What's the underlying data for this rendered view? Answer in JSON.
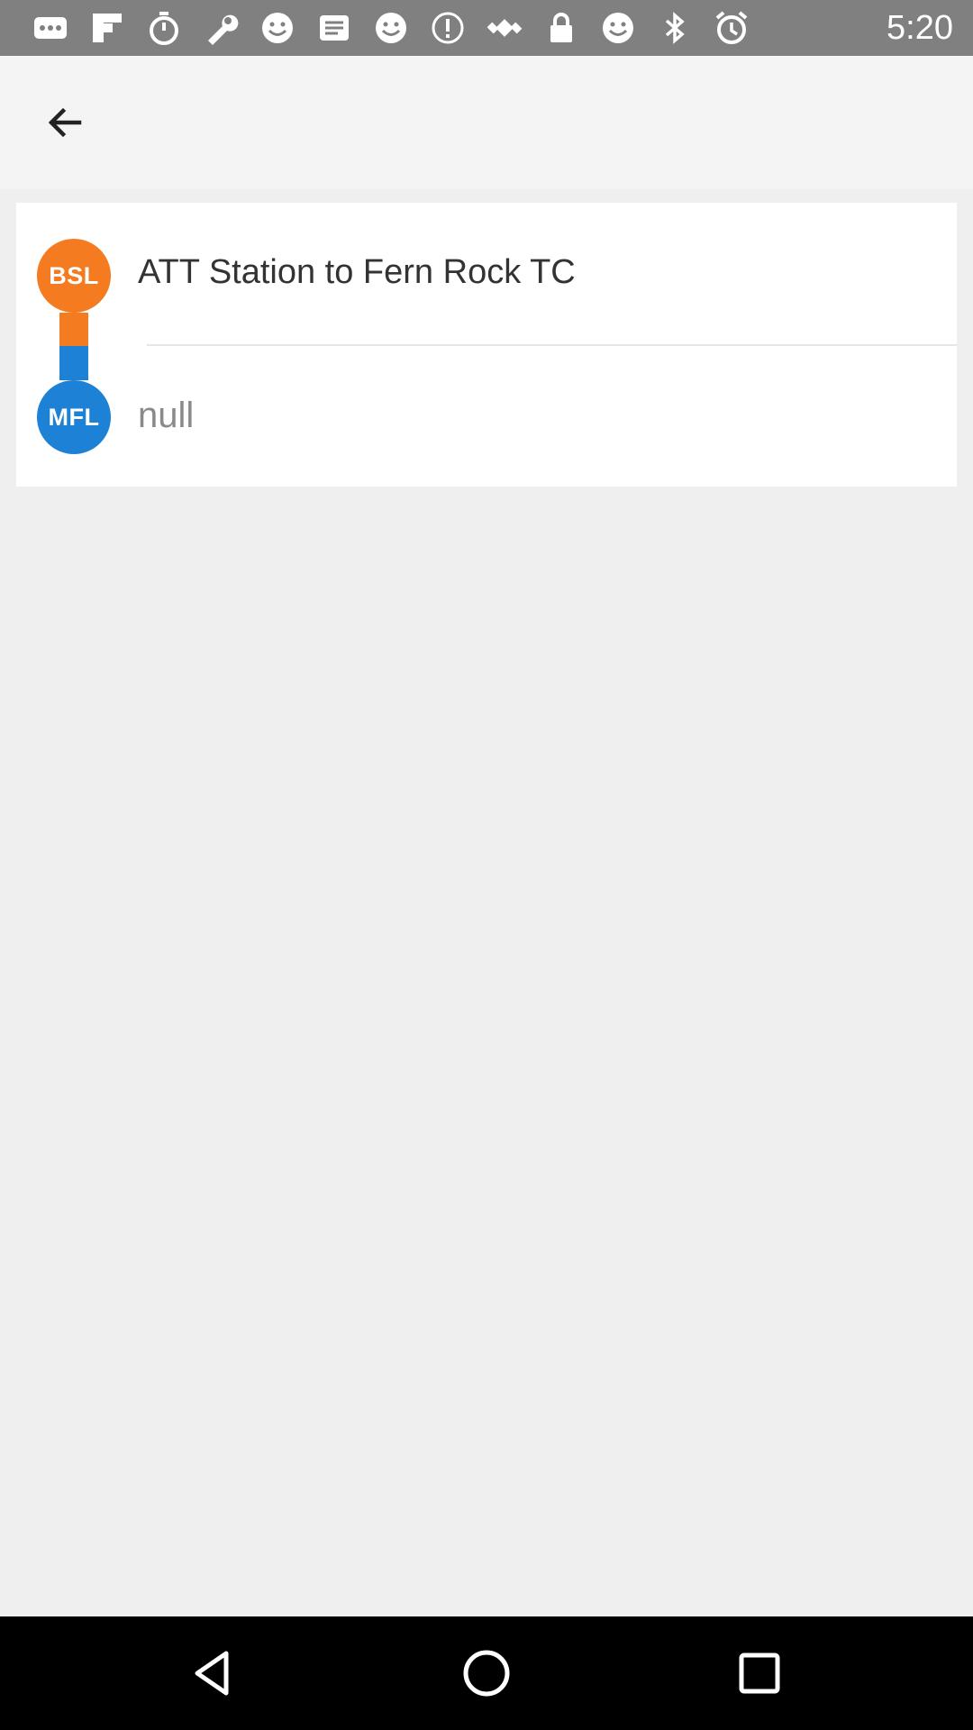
{
  "status_bar": {
    "time": "5:20",
    "icons": [
      "more-icon",
      "flipboard-icon",
      "timer-icon",
      "wrench-icon",
      "smiley-icon",
      "taobao-icon",
      "smiley-icon",
      "alert-icon",
      "fake-gps-icon",
      "lock-icon",
      "smiley-icon",
      "bluetooth-icon",
      "alarm-icon"
    ]
  },
  "app_bar": {
    "back_icon": "arrow-back-icon"
  },
  "route": {
    "from_badge": "BSL",
    "to_badge": "MFL",
    "title": "ATT Station to Fern Rock TC",
    "subtitle": "null",
    "colors": {
      "from": "#f47b20",
      "to": "#1d82d6"
    }
  },
  "nav_bar": {
    "icons": [
      "back-triangle-icon",
      "home-circle-icon",
      "recents-square-icon"
    ]
  }
}
